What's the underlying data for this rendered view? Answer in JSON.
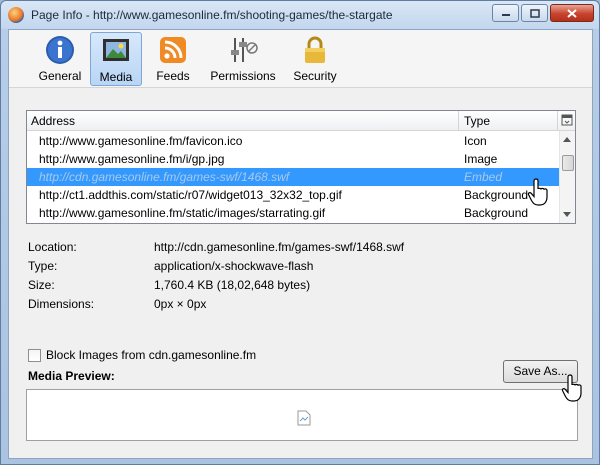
{
  "window": {
    "title": "Page Info - http://www.gamesonline.fm/shooting-games/the-stargate"
  },
  "tabs": [
    {
      "label": "General",
      "icon": "info-icon"
    },
    {
      "label": "Media",
      "icon": "media-icon",
      "selected": true
    },
    {
      "label": "Feeds",
      "icon": "rss-feed-icon"
    },
    {
      "label": "Permissions",
      "icon": "permissions-sliders-icon"
    },
    {
      "label": "Security",
      "icon": "padlock-icon"
    }
  ],
  "media_list": {
    "headers": {
      "address": "Address",
      "type": "Type"
    },
    "rows": [
      {
        "address": "http://www.gamesonline.fm/favicon.ico",
        "type": "Icon"
      },
      {
        "address": "http://www.gamesonline.fm/i/gp.jpg",
        "type": "Image"
      },
      {
        "address": "http://cdn.gamesonline.fm/games-swf/1468.swf",
        "type": "Embed",
        "selected": true
      },
      {
        "address": "http://ct1.addthis.com/static/r07/widget013_32x32_top.gif",
        "type": "Background"
      },
      {
        "address": "http://www.gamesonline.fm/static/images/starrating.gif",
        "type": "Background"
      }
    ]
  },
  "details": {
    "location_label": "Location:",
    "location_value": "http://cdn.gamesonline.fm/games-swf/1468.swf",
    "type_label": "Type:",
    "type_value": "application/x-shockwave-flash",
    "size_label": "Size:",
    "size_value": "1,760.4 KB (18,02,648 bytes)",
    "dimensions_label": "Dimensions:",
    "dimensions_value": "0px × 0px"
  },
  "block_images_label": "Block Images from cdn.gamesonline.fm",
  "save_as_label": "Save As...",
  "media_preview_label": "Media Preview:",
  "colors": {
    "selection": "#3399ff",
    "titlebar": "#c7d9ee",
    "close_button": "#c8442d"
  }
}
